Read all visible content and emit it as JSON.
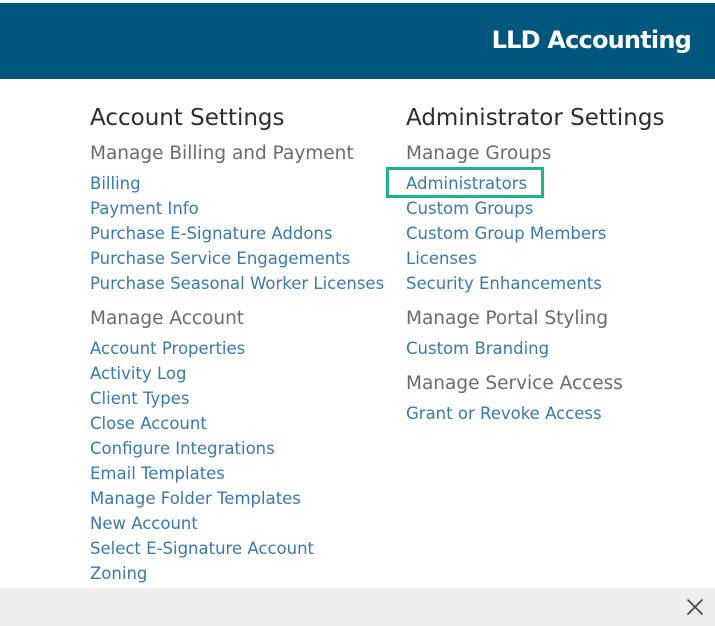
{
  "header": {
    "title": "LLD Accounting"
  },
  "account_settings": {
    "heading": "Account Settings",
    "sections": [
      {
        "title": "Manage Billing and Payment",
        "links": [
          "Billing",
          "Payment Info",
          "Purchase E-Signature Addons",
          "Purchase Service Engagements",
          "Purchase Seasonal Worker Licenses"
        ]
      },
      {
        "title": "Manage Account",
        "links": [
          "Account Properties",
          "Activity Log",
          "Client Types",
          "Close Account",
          "Configure Integrations",
          "Email Templates",
          "Manage Folder Templates",
          "New Account",
          "Select E-Signature Account",
          "Zoning"
        ]
      }
    ]
  },
  "administrator_settings": {
    "heading": "Administrator Settings",
    "sections": [
      {
        "title": "Manage Groups",
        "links": [
          "Administrators",
          "Custom Groups",
          "Custom Group Members",
          "Licenses",
          "Security Enhancements"
        ]
      },
      {
        "title": "Manage Portal Styling",
        "links": [
          "Custom Branding"
        ]
      },
      {
        "title": "Manage Service Access",
        "links": [
          "Grant or Revoke Access"
        ]
      }
    ]
  },
  "highlighted_link": "Administrators",
  "icons": {
    "close": "close-icon"
  },
  "colors": {
    "header_bg": "#00567d",
    "link": "#3a79ae",
    "highlight": "#1fb38a",
    "footer_bg": "#eeeeee"
  }
}
